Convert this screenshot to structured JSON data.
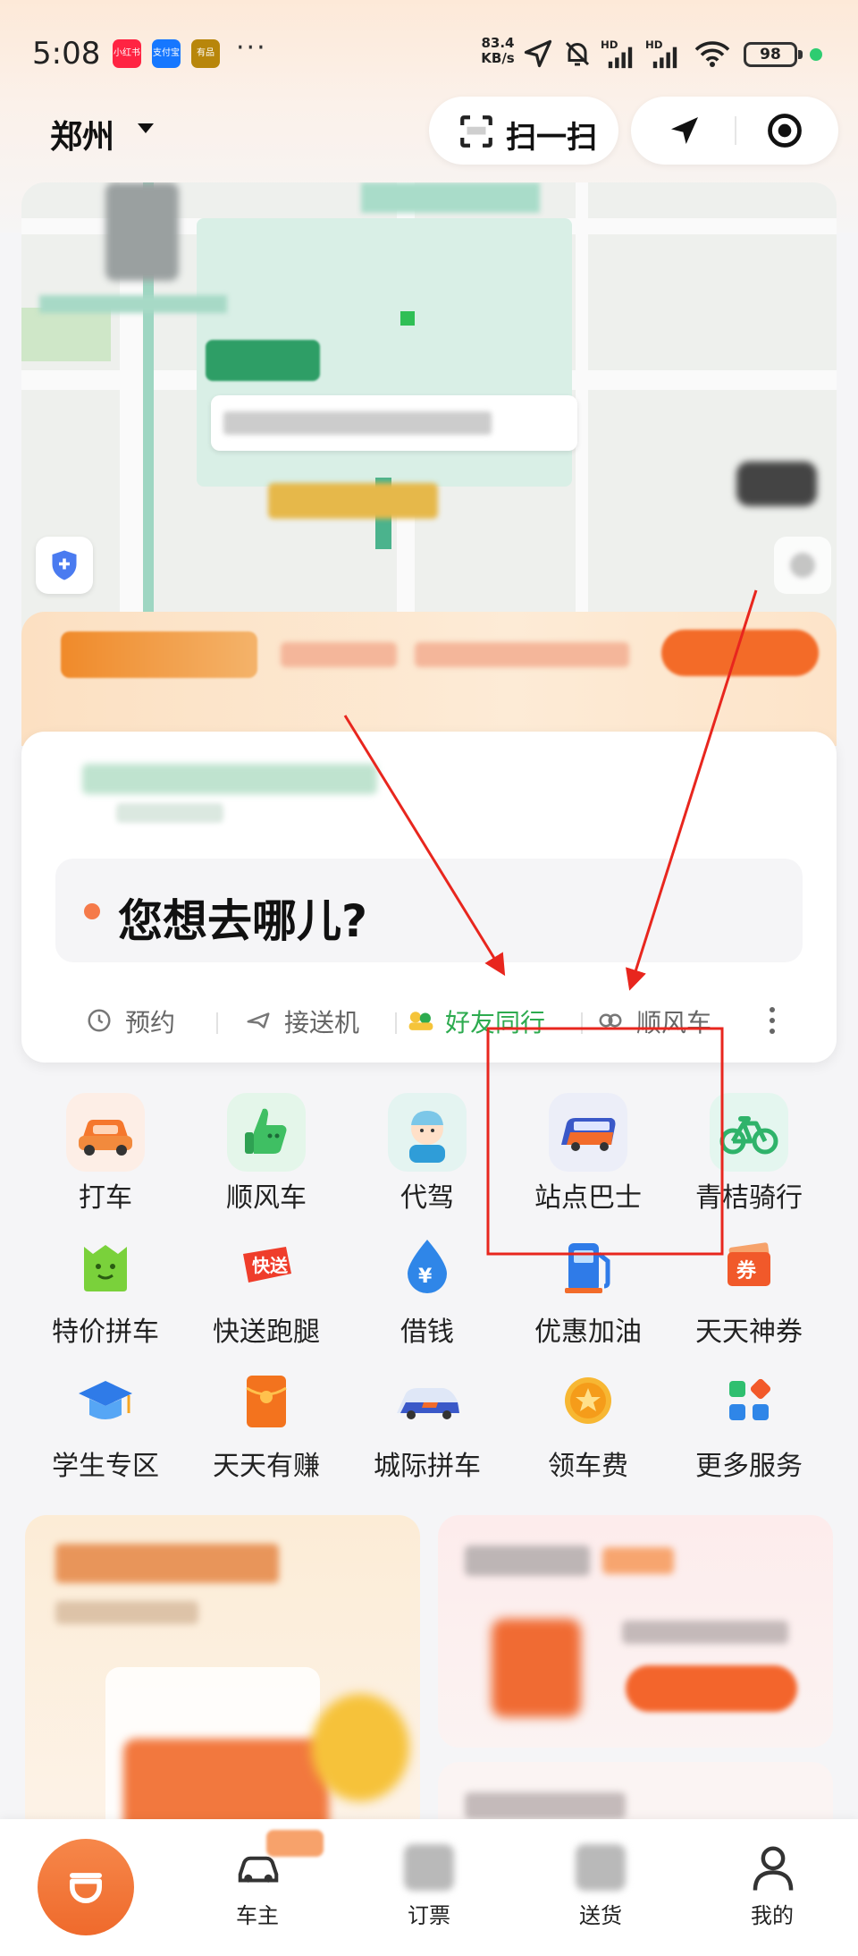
{
  "status_bar": {
    "time": "5:08",
    "dots": "···",
    "net_speed_value": "83.4",
    "net_speed_unit": "KB/s",
    "battery": "98",
    "app_badges": [
      {
        "label": "小红书",
        "color": "#ff2442"
      },
      {
        "label": "支付宝",
        "color": "#1677ff"
      },
      {
        "label": "有品",
        "color": "#b8860b"
      }
    ],
    "icons": [
      "location-arrow-icon",
      "mute-bell-icon",
      "signal-hd-icon",
      "signal-hd-icon",
      "wifi-icon"
    ]
  },
  "header": {
    "city": "郑州",
    "scan_label": "扫一扫",
    "locate_icon": "navigation-arrow-icon",
    "target_icon": "target-icon"
  },
  "destination": {
    "prompt": "您想去哪儿?",
    "options": [
      {
        "label": "预约",
        "icon": "clock-icon",
        "color": "#666666"
      },
      {
        "label": "接送机",
        "icon": "plane-icon",
        "color": "#666666"
      },
      {
        "label": "好友同行",
        "icon": "friends-icon",
        "color": "#2dab4f"
      },
      {
        "label": "顺风车",
        "icon": "hitch-icon",
        "color": "#666666"
      }
    ]
  },
  "services": [
    {
      "label": "打车",
      "icon": "taxi-car-icon"
    },
    {
      "label": "顺风车",
      "icon": "thumbs-up-icon"
    },
    {
      "label": "代驾",
      "icon": "driver-avatar-icon"
    },
    {
      "label": "站点巴士",
      "icon": "bus-icon"
    },
    {
      "label": "青桔骑行",
      "icon": "bicycle-icon"
    },
    {
      "label": "特价拼车",
      "icon": "smile-bag-icon"
    },
    {
      "label": "快送跑腿",
      "icon": "express-icon"
    },
    {
      "label": "借钱",
      "icon": "yuan-drop-icon"
    },
    {
      "label": "优惠加油",
      "icon": "fuel-pump-icon"
    },
    {
      "label": "天天神券",
      "icon": "coupon-icon"
    },
    {
      "label": "学生专区",
      "icon": "graduation-cap-icon"
    },
    {
      "label": "天天有赚",
      "icon": "red-envelope-icon"
    },
    {
      "label": "城际拼车",
      "icon": "intercity-car-icon"
    },
    {
      "label": "领车费",
      "icon": "star-coin-icon"
    },
    {
      "label": "更多服务",
      "icon": "grid-more-icon"
    }
  ],
  "tabbar": [
    {
      "label": "",
      "icon": "didi-home-icon"
    },
    {
      "label": "车主",
      "icon": "car-owner-icon"
    },
    {
      "label": "订票",
      "icon": "ticket-icon"
    },
    {
      "label": "送货",
      "icon": "truck-icon"
    },
    {
      "label": "我的",
      "icon": "user-icon"
    }
  ],
  "colors": {
    "accent_orange": "#f36b28",
    "annotation_red": "#e8261e",
    "friend_green": "#2dab4f"
  }
}
